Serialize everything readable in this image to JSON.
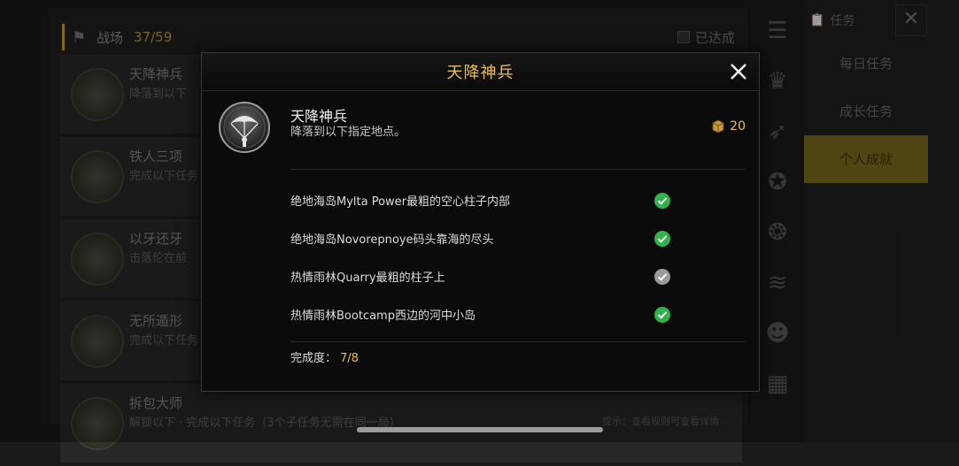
{
  "background": {
    "header": {
      "title": "战场",
      "count": "37/59",
      "achieved_label": "已达成"
    },
    "list": [
      {
        "name": "天降神兵",
        "desc": "降落到以下"
      },
      {
        "name": "铁人三项",
        "desc": "完成以下任务"
      },
      {
        "name": "以牙还牙",
        "desc": "击落伦在前"
      },
      {
        "name": "无所遁形",
        "desc": "完成以下任务"
      },
      {
        "name": "拆包大师",
        "desc": "解锁以下 · 完成以下任务（3个子任务无需在同一局）"
      }
    ],
    "right_panel": {
      "top_label": "任务",
      "tabs": [
        "每日任务",
        "成长任务",
        "个人成就"
      ],
      "active_tab": "个人成就"
    },
    "hint": "提示：查看规则可查看详情"
  },
  "modal": {
    "title": "天降神兵",
    "achievement": {
      "name": "天降神兵",
      "description": "降落到以下指定地点。",
      "reward_value": "20",
      "icon": "parachute-icon"
    },
    "tasks": [
      {
        "label": "绝地海岛Mylta Power最粗的空心柱子内部",
        "done": true
      },
      {
        "label": "绝地海岛Novorepnoye码头靠海的尽头",
        "done": true
      },
      {
        "label": "热情雨林Quarry最粗的柱子上",
        "done": false
      },
      {
        "label": "热情雨林Bootcamp西边的河中小岛",
        "done": true
      }
    ],
    "progress_label": "完成度：",
    "progress_value": "7/8"
  },
  "colors": {
    "accent": "#e7c04a",
    "check_done": "#2fb34a",
    "check_pending": "#9a9a9a"
  }
}
